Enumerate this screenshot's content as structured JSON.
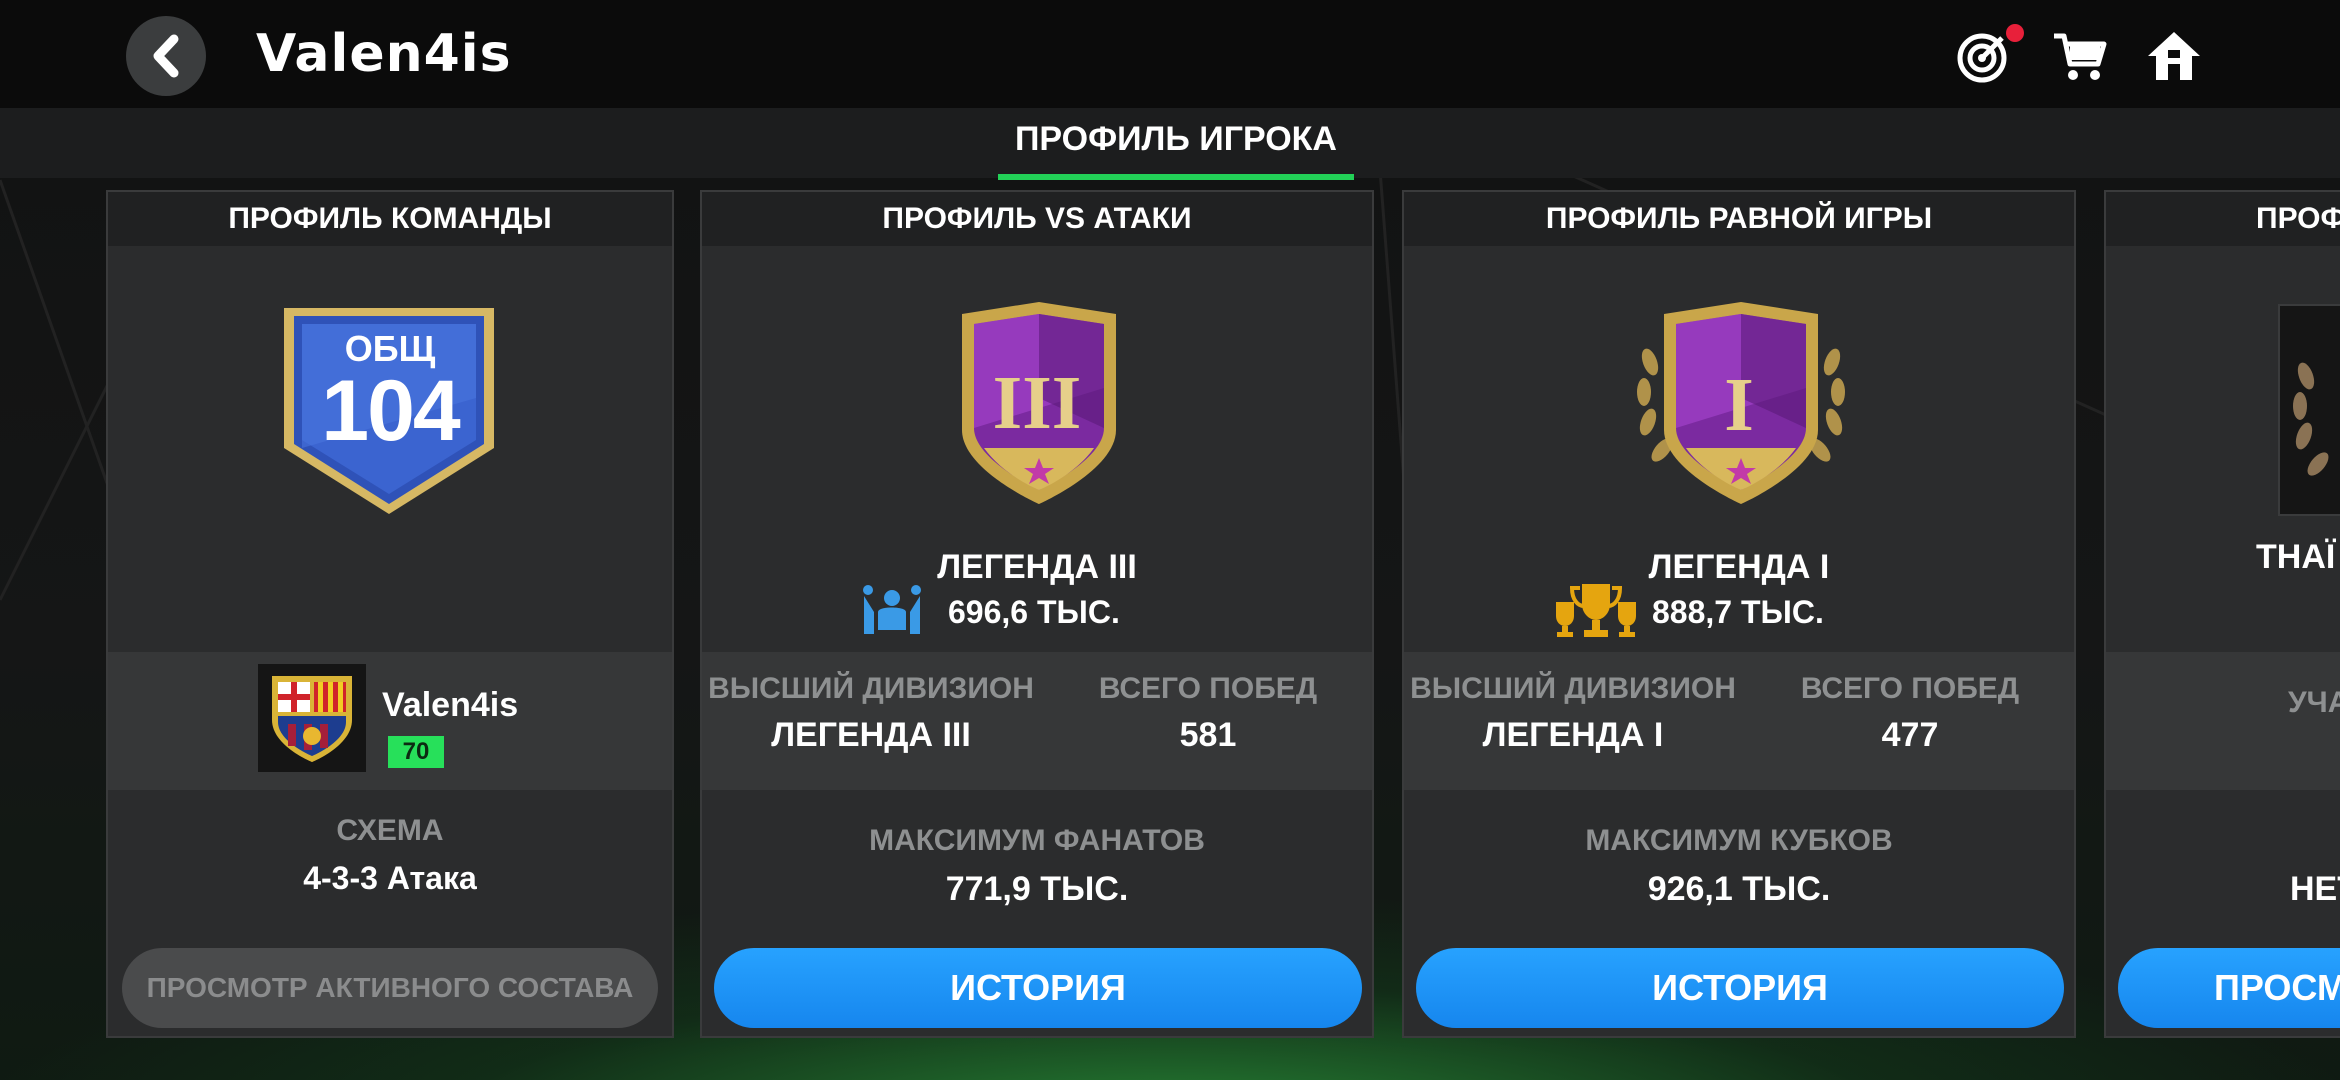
{
  "header": {
    "player_name": "Valen4is",
    "icons": [
      "back-icon",
      "target-icon",
      "cart-icon",
      "home-icon"
    ],
    "notification_dot_color": "#e8203a"
  },
  "tabs": {
    "active": "ПРОФИЛЬ ИГРОКА",
    "accent_color": "#22d157"
  },
  "team_card": {
    "title": "ПРОФИЛЬ КОМАНДЫ",
    "ovr_label": "ОБЩ",
    "ovr_value": "104",
    "club_name": "Valen4is",
    "level": "70",
    "formation_label": "СХЕМА",
    "formation_value": "4-3-3 Атака",
    "button": "ПРОСМОТР АКТИВНОГО СОСТАВА"
  },
  "vs_attack_card": {
    "title": "ПРОФИЛЬ VS АТАКИ",
    "rank_numeral": "III",
    "rank_name": "ЛЕГЕНДА III",
    "points": "696,6 ТЫС.",
    "best_division_label": "ВЫСШИЙ ДИВИЗИОН",
    "best_division_value": "ЛЕГЕНДА III",
    "total_wins_label": "ВСЕГО ПОБЕД",
    "total_wins_value": "581",
    "max_label": "МАКСИМУМ ФАНАТОВ",
    "max_value": "771,9 ТЫС.",
    "button": "ИСТОРИЯ"
  },
  "h2h_card": {
    "title": "ПРОФИЛЬ РАВНОЙ ИГРЫ",
    "rank_numeral": "I",
    "rank_name": "ЛЕГЕНДА I",
    "points": "888,7 ТЫС.",
    "best_division_label": "ВЫСШИЙ ДИВИЗИОН",
    "best_division_value": "ЛЕГЕНДА I",
    "total_wins_label": "ВСЕГО ПОБЕД",
    "total_wins_value": "477",
    "max_label": "МАКСИМУМ КУБКОВ",
    "max_value": "926,1 ТЫС.",
    "button": "ИСТОРИЯ"
  },
  "partial_card": {
    "title": "ПРОФ",
    "name": "THAÏ",
    "label": "УЧА",
    "value": "НЕТ",
    "button": "ПРОСМ"
  }
}
